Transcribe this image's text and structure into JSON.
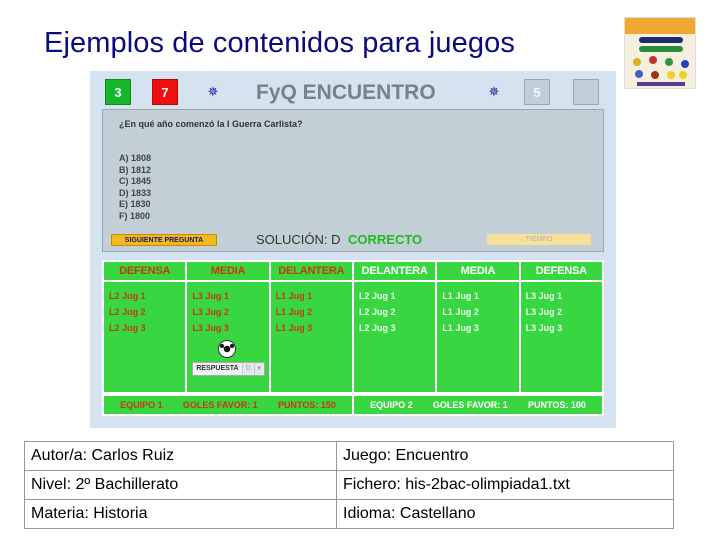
{
  "slide": {
    "title": "Ejemplos de contenidos para juegos"
  },
  "thumbnail": {
    "icon": "cover-thumbnail-image"
  },
  "game": {
    "title": "FyQ ENCUENTRO",
    "counters": {
      "green": "3",
      "red": "7",
      "grey": "5",
      "grey2": ""
    },
    "icons": {
      "left": "bug-icon",
      "right": "bug-icon"
    },
    "question": "¿En qué año comenzó la I Guerra Carlista?",
    "options": [
      "A) 1808",
      "B) 1812",
      "C) 1845",
      "D) 1833",
      "E) 1830",
      "F) 1800"
    ],
    "next_button": "SIGUIENTE PREGUNTA",
    "solution": "SOLUCIÓN: D",
    "result": "CORRECTO",
    "time_button": "TIEMPO",
    "colors": {
      "team1_text": "#c83a0a",
      "team2_text": "#ffffff",
      "field": "#38d640",
      "correct": "#22b822"
    },
    "columns": [
      {
        "header": "DEFENSA",
        "team": 1,
        "players": [
          "L2 Jug 1",
          "L2 Jug 2",
          "L2 Jug 3"
        ]
      },
      {
        "header": "MEDIA",
        "team": 1,
        "players": [
          "L3 Jug 1",
          "L3 Jug 2",
          "L3 Jug 3"
        ]
      },
      {
        "header": "DELANTERA",
        "team": 1,
        "players": [
          "L1 Jug 1",
          "L1 Jug 2",
          "L1 Jug 3"
        ]
      },
      {
        "header": "DELANTERA",
        "team": 2,
        "players": [
          "L2 Jug 1",
          "L2 Jug 2",
          "L2 Jug 3"
        ]
      },
      {
        "header": "MEDIA",
        "team": 2,
        "players": [
          "L1 Jug 1",
          "L1 Jug 2",
          "L1 Jug 3"
        ]
      },
      {
        "header": "DEFENSA",
        "team": 2,
        "players": [
          "L3 Jug 1",
          "L3 Jug 2",
          "L3 Jug 3"
        ]
      }
    ],
    "answer": {
      "label": "RESPUESTA",
      "value": "D",
      "arrow": "▼"
    },
    "scores": [
      {
        "team": "EQUIPO 1",
        "goals": "GOLES FAVOR: 1",
        "points": "PUNTOS: 150"
      },
      {
        "team": "EQUIPO 2",
        "goals": "GOLES FAVOR: 1",
        "points": "PUNTOS: 100"
      }
    ]
  },
  "info_table": [
    [
      "Autor/a: Carlos Ruiz",
      "Juego: Encuentro"
    ],
    [
      "Nivel: 2º Bachillerato",
      "Fichero: his-2bac-olimpiada1.txt"
    ],
    [
      "Materia: Historia",
      "Idioma: Castellano"
    ]
  ]
}
